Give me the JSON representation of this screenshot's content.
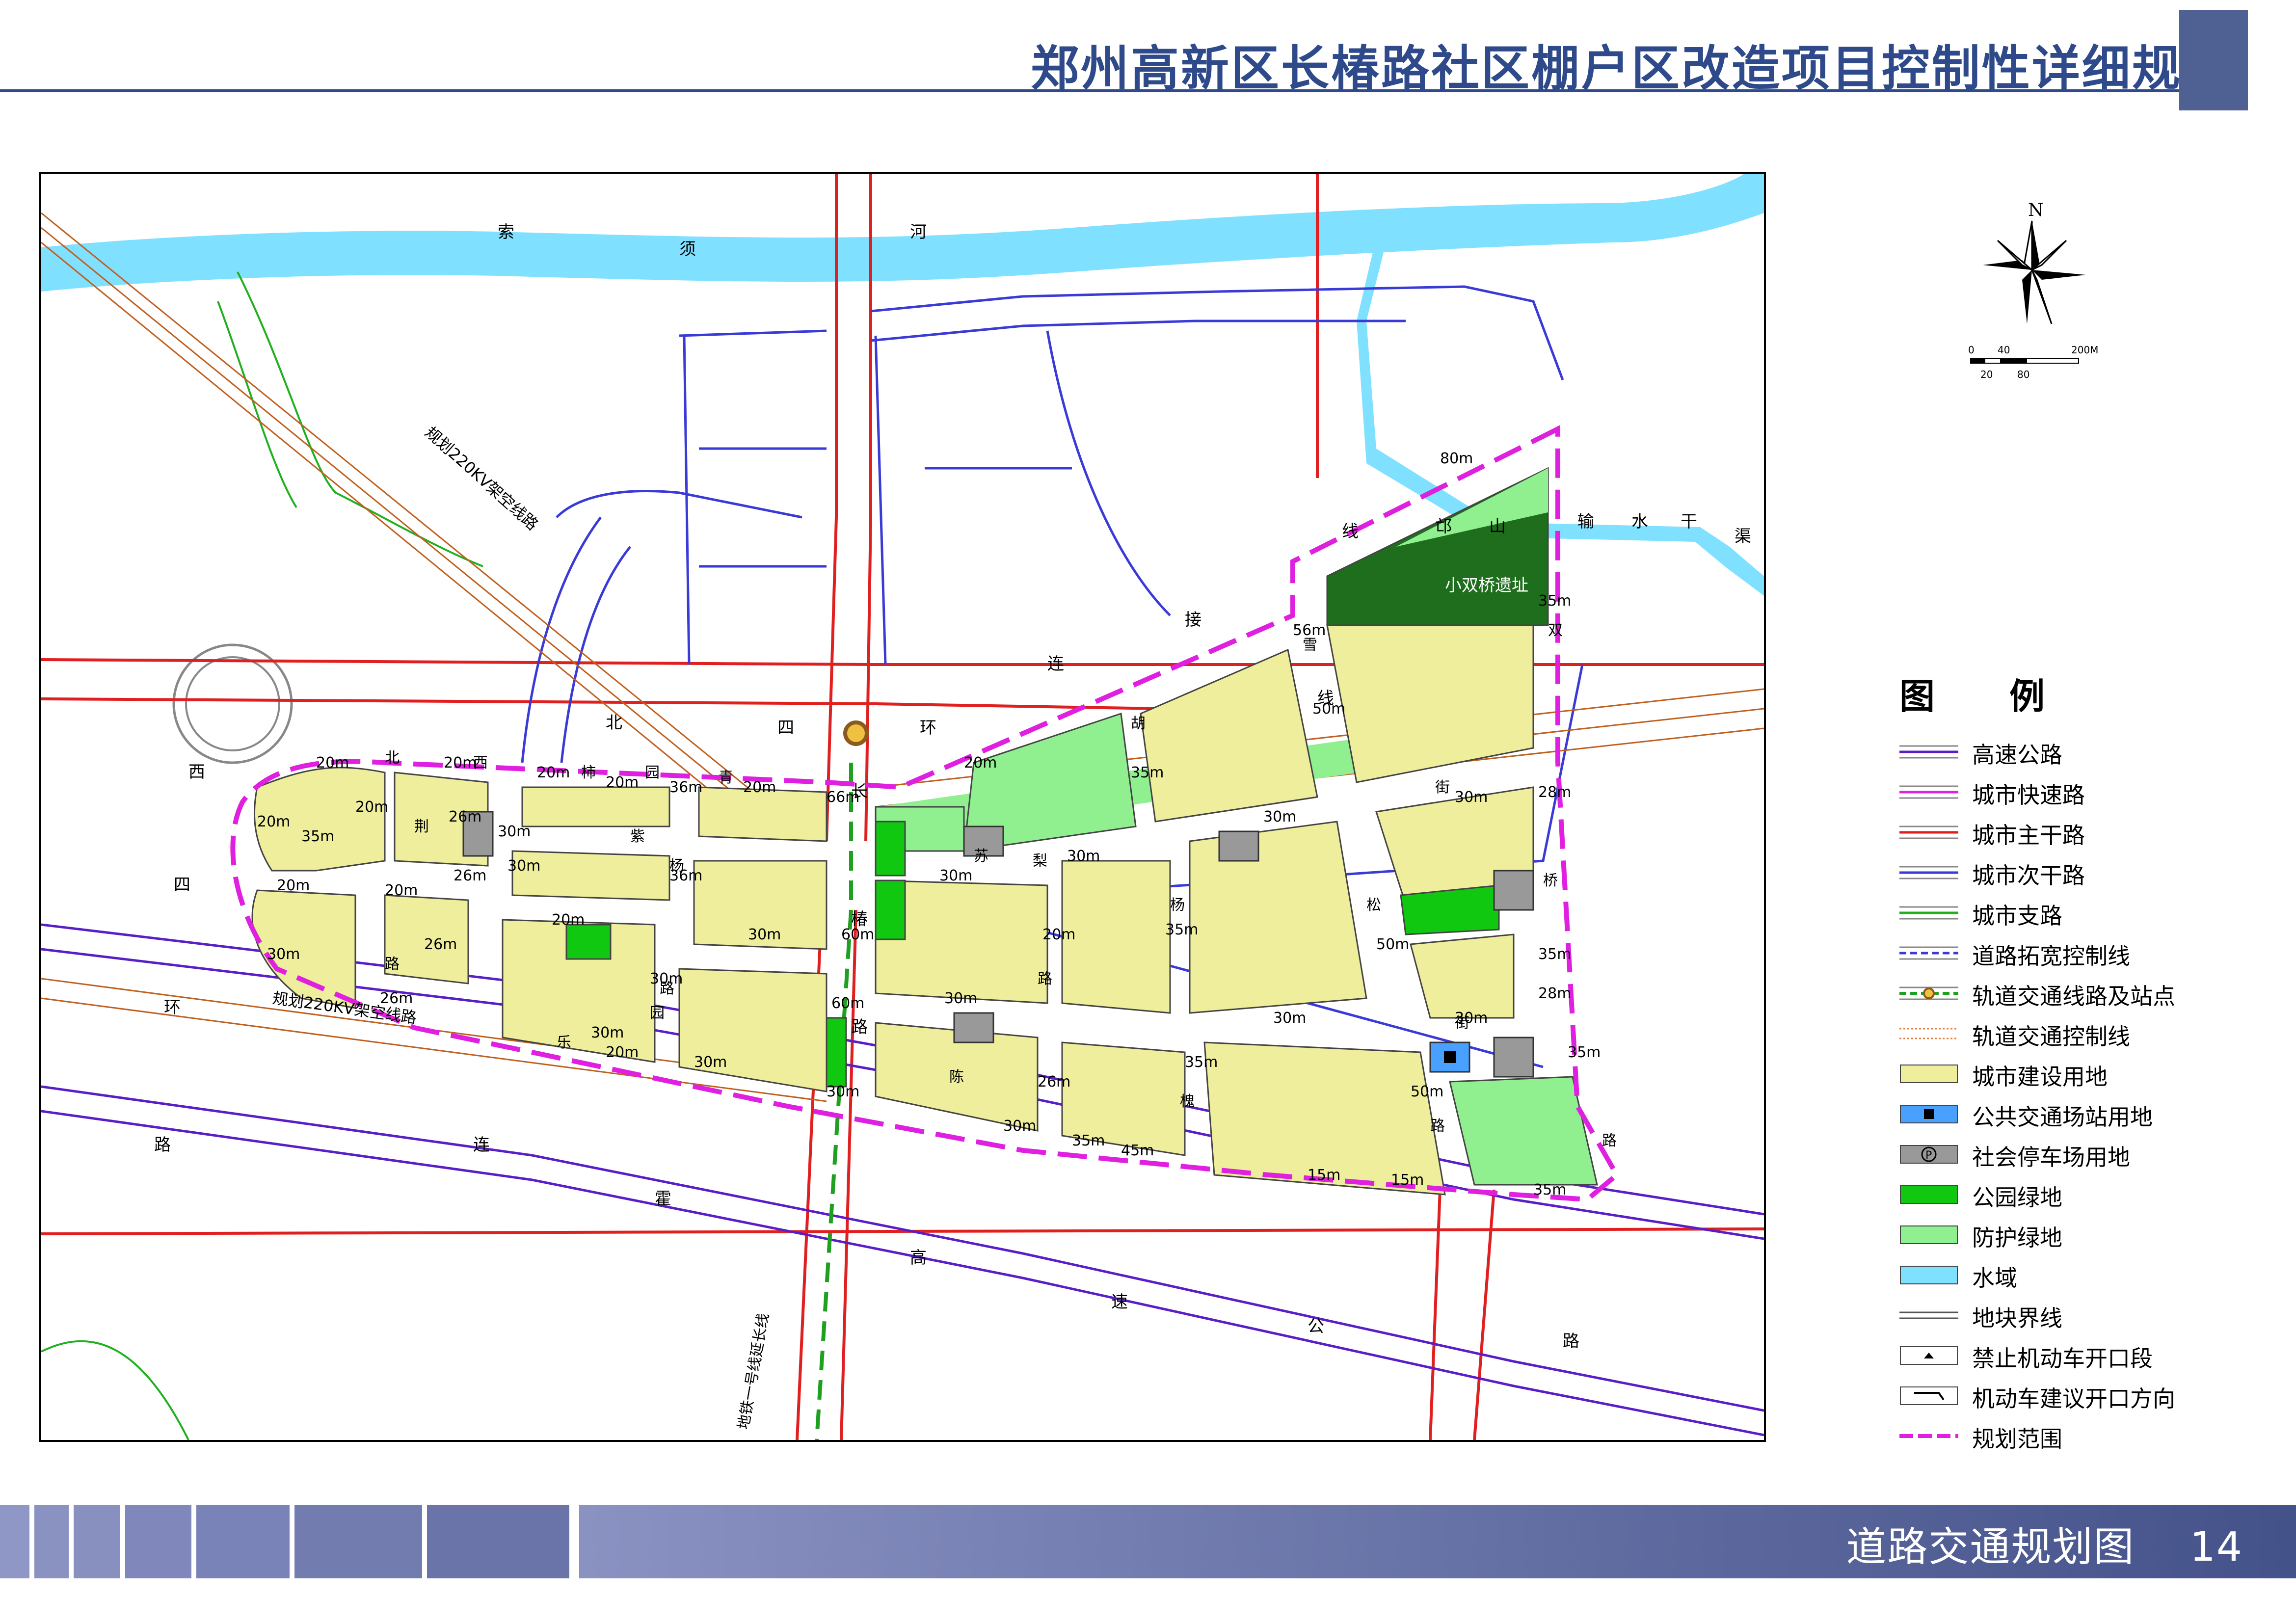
{
  "header": {
    "title": "郑州高新区长椿路社区棚户区改造项目控制性详细规划"
  },
  "footer": {
    "title": "道路交通规划图",
    "page": "14"
  },
  "compass": {
    "north_label": "N"
  },
  "scale": {
    "ticks_top": [
      "0",
      "40",
      "200M"
    ],
    "ticks_bottom": [
      "20",
      "80"
    ]
  },
  "legend": {
    "title": "图　例",
    "items": [
      {
        "label": "高速公路",
        "kind": "line",
        "color": "#5a1ec8",
        "style": "double"
      },
      {
        "label": "城市快速路",
        "kind": "line",
        "color": "#e020e0",
        "style": "double"
      },
      {
        "label": "城市主干路",
        "kind": "line",
        "color": "#e02020",
        "style": "double"
      },
      {
        "label": "城市次干路",
        "kind": "line",
        "color": "#3a3ad8",
        "style": "double"
      },
      {
        "label": "城市支路",
        "kind": "line",
        "color": "#20b020",
        "style": "double"
      },
      {
        "label": "道路拓宽控制线",
        "kind": "line",
        "color": "#3a3ad8",
        "style": "dashed"
      },
      {
        "label": "轨道交通线路及站点",
        "kind": "line",
        "color": "#20a020",
        "style": "station"
      },
      {
        "label": "轨道交通控制线",
        "kind": "line",
        "color": "#e08040",
        "style": "dotted"
      },
      {
        "label": "城市建设用地",
        "kind": "fill",
        "color": "#eeee9c"
      },
      {
        "label": "公共交通场站用地",
        "kind": "fill",
        "color": "#4aa0ff",
        "icon": "bus-station-icon"
      },
      {
        "label": "社会停车场用地",
        "kind": "fill",
        "color": "#999999",
        "icon": "parking-icon"
      },
      {
        "label": "公园绿地",
        "kind": "fill",
        "color": "#10c810"
      },
      {
        "label": "防护绿地",
        "kind": "fill",
        "color": "#90f090"
      },
      {
        "label": "水域",
        "kind": "fill",
        "color": "#80e0ff"
      },
      {
        "label": "地块界线",
        "kind": "line",
        "color": "#555555",
        "style": "thin"
      },
      {
        "label": "禁止机动车开口段",
        "kind": "marker",
        "color": "#000000"
      },
      {
        "label": "机动车建议开口方向",
        "kind": "marker2",
        "color": "#000000"
      },
      {
        "label": "规划范围",
        "kind": "line",
        "color": "#e020e0",
        "style": "boundary"
      }
    ]
  },
  "map": {
    "colors": {
      "build": "#eeee9c",
      "park": "#10c810",
      "buffer": "#90f090",
      "water": "#80e0ff",
      "relic": "#1e6e1e",
      "parking": "#999999",
      "bus": "#4aa0ff",
      "boundary": "#e020e0",
      "expressway": "#5a1ec8",
      "arterial": "#e02020",
      "secondary": "#3a3ad8",
      "branch": "#20b020",
      "powerline": "#c06020"
    },
    "labels": {
      "river": [
        "索",
        "须",
        "河"
      ],
      "powerline_top": "规划220KV架空线路",
      "powerline_bottom": "规划220KV架空线路",
      "relic": "小双桥遗址",
      "canal": [
        "线",
        "邙",
        "山",
        "输",
        "水",
        "干",
        "渠"
      ],
      "north_road": [
        "北",
        "四",
        "环"
      ],
      "connector": [
        "接",
        "连",
        "线"
      ],
      "west_road": [
        "西",
        "四",
        "环",
        "路"
      ],
      "highway": [
        "连",
        "霍",
        "高",
        "速",
        "公",
        "路"
      ],
      "chang_road": [
        "长",
        "椿",
        "路"
      ],
      "metro": "地铁一号线延长线",
      "street_names": [
        "北",
        "西",
        "柿",
        "园",
        "青",
        "紫",
        "荆",
        "路",
        "杨",
        "路",
        "苏",
        "梨",
        "胡",
        "雪",
        "杨",
        "松",
        "街",
        "桥",
        "双",
        "街",
        "路",
        "乐",
        "园",
        "陈",
        "路",
        "槐",
        "路"
      ],
      "widths": [
        "20m",
        "20m",
        "20m",
        "20m",
        "30m",
        "36m",
        "20m",
        "66m",
        "20m",
        "56m",
        "50m",
        "35m",
        "80m",
        "35m",
        "28m",
        "30m",
        "30m",
        "30m",
        "30m",
        "36m",
        "30m",
        "60m",
        "35m",
        "20m",
        "30m",
        "50m",
        "35m",
        "28m",
        "20m",
        "20m",
        "35m",
        "26m",
        "30m",
        "60m",
        "26m",
        "30m",
        "30m",
        "35m",
        "30m",
        "50m",
        "35m",
        "26m",
        "30m",
        "20m",
        "26m",
        "30m",
        "30m",
        "30m",
        "35m",
        "45m",
        "15m",
        "15m",
        "35m",
        "20m",
        "26m",
        "30m",
        "20m",
        "20m"
      ]
    }
  }
}
